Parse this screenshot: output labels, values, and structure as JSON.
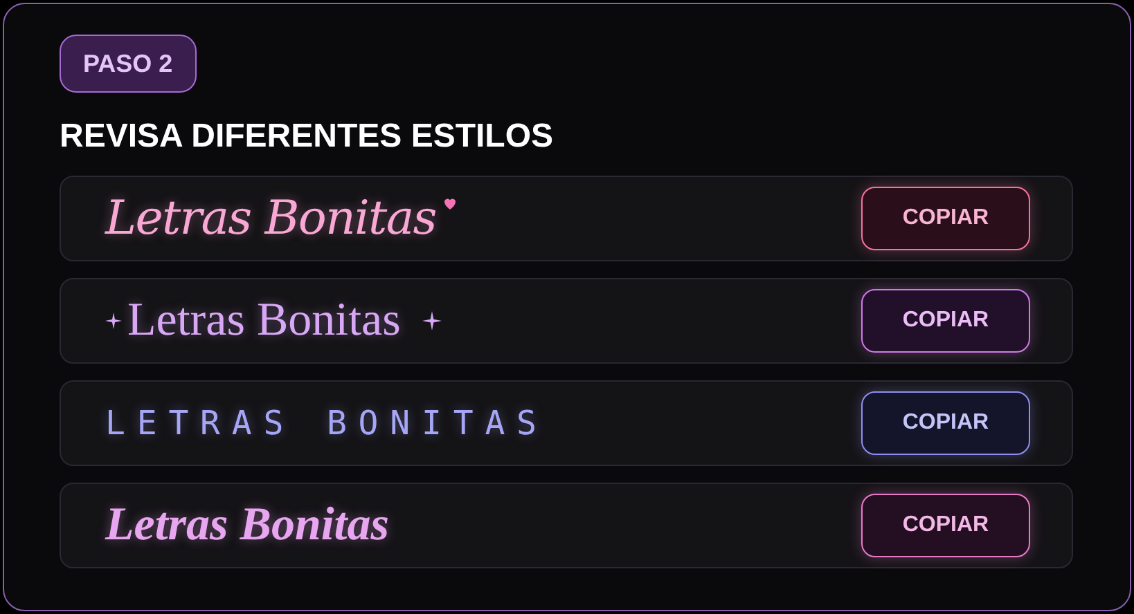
{
  "badge": "PASO 2",
  "title": "REVISA DIFERENTES ESTILOS",
  "styles": [
    {
      "kind": "script",
      "text": "Letras Bonitas",
      "color": "#f9a8d4",
      "button": "COPIAR"
    },
    {
      "kind": "sparkle",
      "text": "Letras Bonitas",
      "color": "#d8a8f5",
      "button": "COPIAR"
    },
    {
      "kind": "spaced",
      "text": "LETRAS BONITAS",
      "color": "#a5a6f6",
      "button": "COPIAR"
    },
    {
      "kind": "gothic",
      "text": "Letras Bonitas",
      "color": "#e9a6f0",
      "button": "COPIAR"
    }
  ]
}
